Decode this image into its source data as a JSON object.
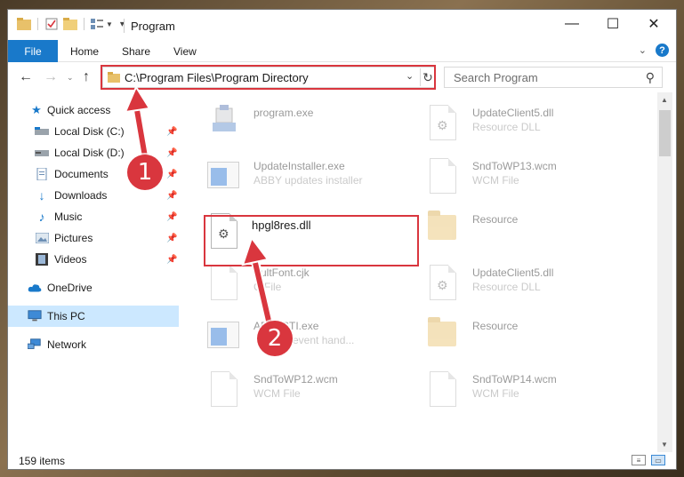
{
  "window": {
    "title": "Program",
    "controls": {
      "minimize": "—",
      "maximize": "☐",
      "close": "✕"
    }
  },
  "ribbon": {
    "file_tab": "File",
    "tabs": [
      "Home",
      "Share",
      "View"
    ]
  },
  "address_bar": {
    "path": "C:\\Program Files\\Program Directory",
    "search_placeholder": "Search Program"
  },
  "sidebar": {
    "quick_access": "Quick access",
    "items": [
      {
        "label": "Local Disk (C:)",
        "icon": "drive-icon",
        "pinned": true
      },
      {
        "label": "Local Disk (D:)",
        "icon": "drive-icon",
        "pinned": true
      },
      {
        "label": "Documents",
        "icon": "documents-icon",
        "pinned": true
      },
      {
        "label": "Downloads",
        "icon": "downloads-icon",
        "pinned": true
      },
      {
        "label": "Music",
        "icon": "music-icon",
        "pinned": true
      },
      {
        "label": "Pictures",
        "icon": "pictures-icon",
        "pinned": true
      },
      {
        "label": "Videos",
        "icon": "videos-icon",
        "pinned": true
      }
    ],
    "onedrive": "OneDrive",
    "this_pc": "This PC",
    "network": "Network"
  },
  "files": [
    {
      "name": "program.exe",
      "sub": "",
      "icon": "exe-icon"
    },
    {
      "name": "UpdateClient5.dll",
      "sub": "Resource DLL",
      "icon": "dll-icon"
    },
    {
      "name": "UpdateInstaller.exe",
      "sub": "ABBY updates installer",
      "icon": "app-icon"
    },
    {
      "name": "SndToWP13.wcm",
      "sub": "WCM File",
      "icon": "file-icon"
    },
    {
      "name": "hpgl8res.dll",
      "sub": "",
      "icon": "dll-icon"
    },
    {
      "name": "Resource",
      "sub": "",
      "icon": "folder-icon"
    },
    {
      "name": "ultFont.cjk",
      "sub": "C   File",
      "icon": "file-icon"
    },
    {
      "name": "UpdateClient5.dll",
      "sub": "Resource DLL",
      "icon": "dll-icon"
    },
    {
      "name": "ABBYSTI.exe",
      "sub": "event hand...",
      "icon": "app-icon"
    },
    {
      "name": "Resource",
      "sub": "",
      "icon": "folder-icon"
    },
    {
      "name": "SndToWP12.wcm",
      "sub": "WCM File",
      "icon": "file-icon"
    },
    {
      "name": "SndToWP14.wcm",
      "sub": "WCM File",
      "icon": "file-icon"
    }
  ],
  "status": {
    "items": "159 items"
  },
  "annotations": {
    "step1": "1",
    "step2": "2"
  },
  "colors": {
    "accent": "#1979ca",
    "callout": "#d9363e",
    "selection": "#cce8ff"
  }
}
